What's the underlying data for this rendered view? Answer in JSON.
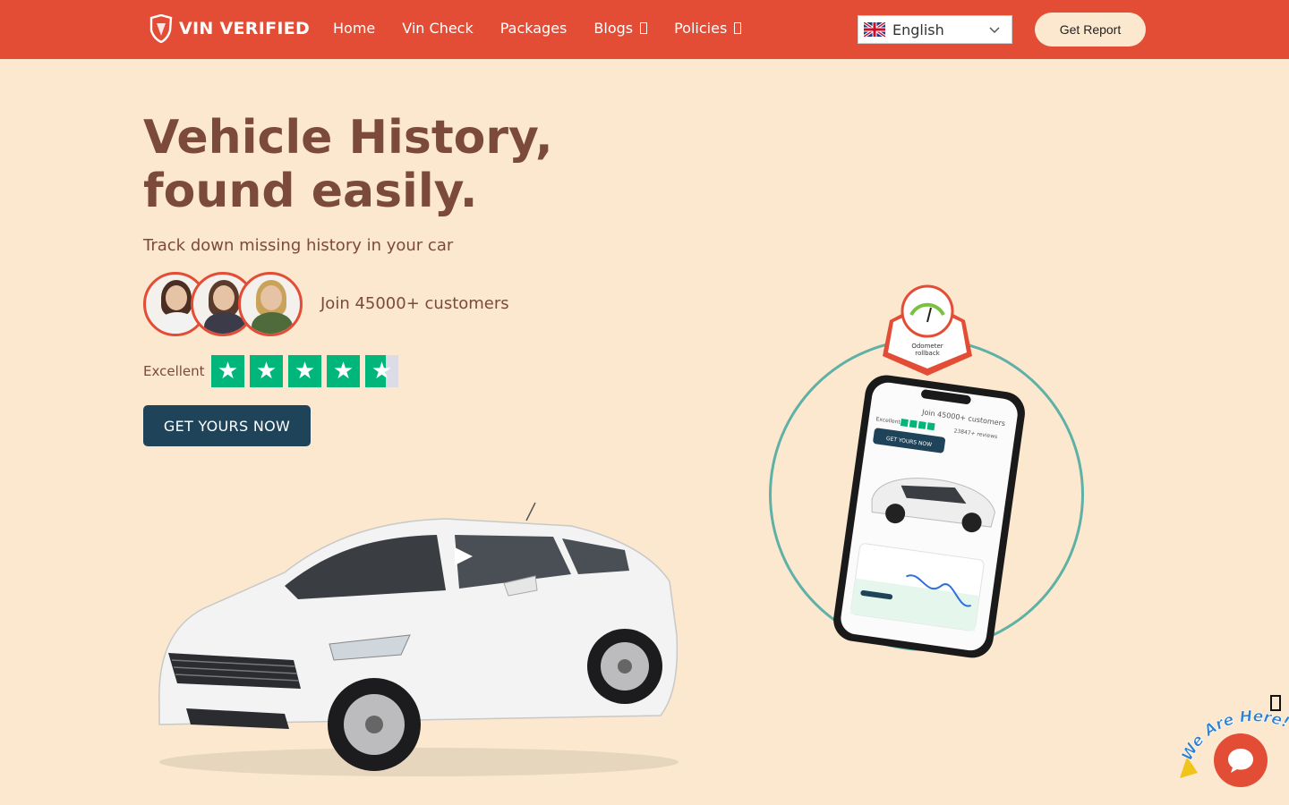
{
  "header": {
    "logo_text": "VIN VERIFIED",
    "nav": [
      {
        "label": "Home",
        "has_caret": false
      },
      {
        "label": "Vin Check",
        "has_caret": false
      },
      {
        "label": "Packages",
        "has_caret": false
      },
      {
        "label": "Blogs",
        "has_caret": true
      },
      {
        "label": "Policies",
        "has_caret": true
      }
    ],
    "language": "English",
    "get_report": "Get Report"
  },
  "hero": {
    "title_line1": "Vehicle History,",
    "title_line2": "found easily.",
    "subtitle": "Track down missing history in your car",
    "customers": "Join 45000+ customers",
    "rating_label": "Excellent",
    "rating_stars": 4.5,
    "cta": "GET YOURS NOW"
  },
  "phone_illustration": {
    "badge_line1": "Odometer",
    "badge_line2": "rollback",
    "screen_customers": "Join 45000+ customers",
    "screen_rating": "Excellent",
    "screen_reviews": "23847+ reviews",
    "screen_cta": "GET YOURS NOW"
  },
  "chat": {
    "badge_text": "We Are Here!"
  },
  "colors": {
    "header_bg": "#e34c35",
    "page_bg": "#fbe8cf",
    "title": "#7c4a3a",
    "cta_bg": "#1f4459",
    "star_green": "#00b67a",
    "circle": "#5fb0a5"
  }
}
